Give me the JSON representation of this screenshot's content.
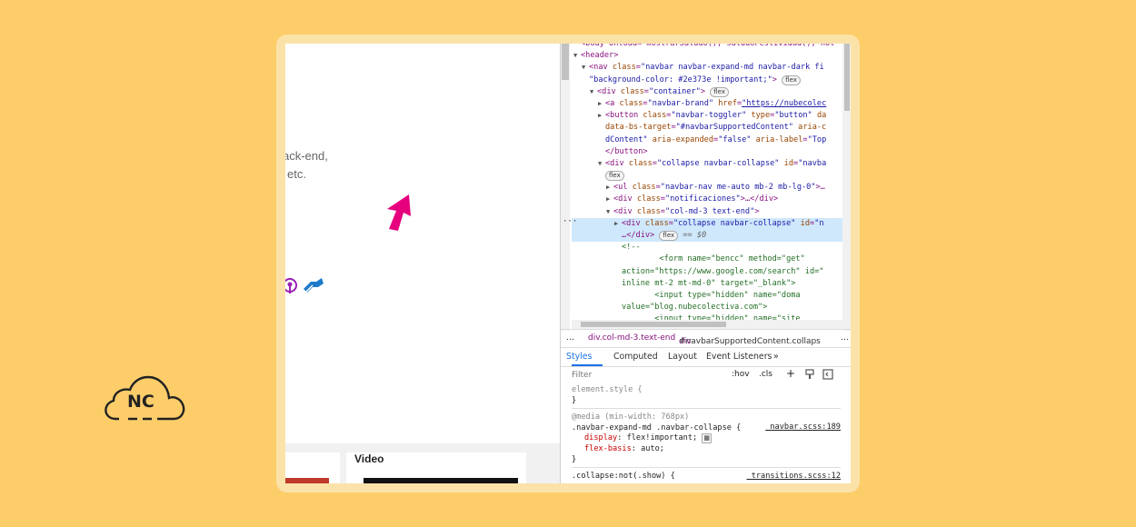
{
  "logo": {
    "text": "NC"
  },
  "page": {
    "text_line1": "ack-end,",
    "text_line2": "etc.",
    "card_title": "Video"
  },
  "dom_tree": {
    "lines": [
      {
        "indent": 0,
        "tri": "",
        "html": "&lt;body onload=\"mostrarSaludo(); saludoFestividad(); not"
      },
      {
        "indent": 0,
        "tri": "▼",
        "html": "<span class='tag'>&lt;header&gt;</span>"
      },
      {
        "indent": 1,
        "tri": "▼",
        "html": "<span class='tag'>&lt;nav</span> <span class='attr'>class</span>=<span class='val'>\"navbar navbar-expand-md navbar-dark fi</span>"
      },
      {
        "indent": 1,
        "tri": "",
        "html": "<span class='val'>\"background-color: #2e373e !important;\"</span><span class='tag'>&gt;</span> <span class='flex'>flex</span>"
      },
      {
        "indent": 2,
        "tri": "▼",
        "html": "<span class='tag'>&lt;div</span> <span class='attr'>class</span>=<span class='val'>\"container\"</span><span class='tag'>&gt;</span> <span class='flex'>flex</span>"
      },
      {
        "indent": 3,
        "tri": "▶",
        "html": "<span class='tag'>&lt;a</span> <span class='attr'>class</span>=<span class='val'>\"navbar-brand\"</span> <span class='attr'>href</span>=<span class='link'>\"https://nubecolec</span>"
      },
      {
        "indent": 3,
        "tri": "▶",
        "html": "<span class='tag'>&lt;button</span> <span class='attr'>class</span>=<span class='val'>\"navbar-toggler\"</span> <span class='attr'>type</span>=<span class='val'>\"button\"</span> <span class='attr'>da</span>"
      },
      {
        "indent": 3,
        "tri": "",
        "html": "<span class='attr'>data-bs-target</span>=<span class='val'>\"#navbarSupportedContent\"</span> <span class='attr'>aria-c</span>"
      },
      {
        "indent": 3,
        "tri": "",
        "html": "<span class='val'>dContent\"</span> <span class='attr'>aria-expanded</span>=<span class='val'>\"false\"</span> <span class='attr'>aria-label</span>=<span class='val'>\"Top</span>"
      },
      {
        "indent": 3,
        "tri": "",
        "html": "<span class='tag'>&lt;/button&gt;</span>"
      },
      {
        "indent": 3,
        "tri": "▼",
        "html": "<span class='tag'>&lt;div</span> <span class='attr'>class</span>=<span class='val'>\"collapse navbar-collapse\"</span> <span class='attr'>id</span>=<span class='val'>\"navba</span>"
      },
      {
        "indent": 3,
        "tri": "",
        "html": "<span class='flex'>flex</span>"
      },
      {
        "indent": 4,
        "tri": "▶",
        "html": "<span class='tag'>&lt;ul</span> <span class='attr'>class</span>=<span class='val'>\"navbar-nav me-auto mb-2 mb-lg-0\"</span><span class='tag'>&gt;</span>…"
      },
      {
        "indent": 4,
        "tri": "▶",
        "html": "<span class='tag'>&lt;div</span> <span class='attr'>class</span>=<span class='val'>\"notificaciones\"</span><span class='tag'>&gt;</span>…<span class='tag'>&lt;/div&gt;</span>"
      },
      {
        "indent": 4,
        "tri": "▼",
        "html": "<span class='tag'>&lt;div</span> <span class='attr'>class</span>=<span class='val'>\"col-md-3 text-end\"</span><span class='tag'>&gt;</span>"
      },
      {
        "indent": 5,
        "tri": "▶",
        "html": "<span class='tag'>&lt;div</span> <span class='attr'>class</span>=<span class='val'>\"collapse navbar-collapse\"</span> <span class='attr'>id</span>=<span class='val'>\"n</span>",
        "selected": true
      },
      {
        "indent": 5,
        "tri": "",
        "html": "…<span class='tag'>&lt;/div&gt;</span> <span class='flex'>flex</span> <span class='eq'>== $0</span>",
        "selected": true
      },
      {
        "indent": 5,
        "tri": "",
        "html": "<span class='cm'>&lt;!--</span>"
      },
      {
        "indent": 5,
        "tri": "",
        "html": "<span class='cm'>        &lt;form name=\"bencc\" method=\"get\"</span>"
      },
      {
        "indent": 5,
        "tri": "",
        "html": "<span class='cm'>action=\"https://www.google.com/search\" id=\"</span>"
      },
      {
        "indent": 5,
        "tri": "",
        "html": "<span class='cm'>inline mt-2 mt-md-0\" target=\"_blank\"&gt;</span>"
      },
      {
        "indent": 5,
        "tri": "",
        "html": "<span class='cm'>       &lt;input type=\"hidden\" name=\"doma</span>"
      },
      {
        "indent": 5,
        "tri": "",
        "html": "<span class='cm'>value=\"blog.nubecolectiva.com\"&gt;</span>"
      },
      {
        "indent": 5,
        "tri": "",
        "html": "<span class='cm'>       &lt;input type=\"hidden\" name=\"site</span>"
      }
    ]
  },
  "breadcrumb": {
    "ellipsis": "…",
    "item1": "div.col-md-3.text-end",
    "item2_prefix": "div",
    "item2_rest": "#navbarSupportedContent.collaps",
    "more": "…"
  },
  "tabs": {
    "styles": "Styles",
    "computed": "Computed",
    "layout": "Layout",
    "event_listeners": "Event Listeners",
    "more": "»"
  },
  "filter": {
    "placeholder": "Filter",
    "hov": ":hov",
    "cls": ".cls",
    "plus": "+"
  },
  "styles": {
    "element_style": "element.style {",
    "close1": "}",
    "media": "@media (min-width: 768px)",
    "selector": ".navbar-expand-md .navbar-collapse {",
    "source1": "_navbar.scss:189",
    "prop1": "display",
    "val1": "flex!important;",
    "prop2": "flex-basis",
    "val2": "auto;",
    "close2": "}",
    "selector2": ".collapse:not(.show) {",
    "source2": "_transitions.scss:12"
  },
  "colors": {
    "background": "#fdcd6a",
    "arrow": "#e6007e",
    "selected_row": "#cfe8fc",
    "tab_active": "#1a73e8"
  }
}
